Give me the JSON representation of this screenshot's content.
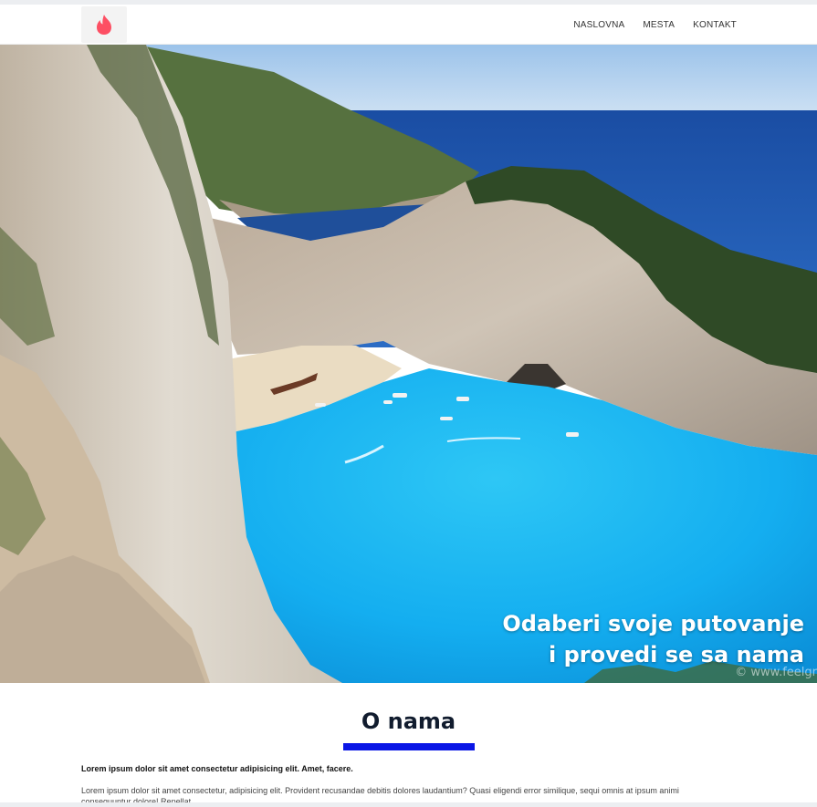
{
  "nav": {
    "items": [
      "NASLOVNA",
      "MESTA",
      "KONTAKT"
    ]
  },
  "hero": {
    "line1": "Odaberi svoje putovanje",
    "line2": "i provedi se sa nama",
    "watermark": "© www.feelgr"
  },
  "about": {
    "title": "O nama",
    "lead": "Lorem ipsum dolor sit amet consectetur adipisicing elit. Amet, facere.",
    "body": "Lorem ipsum dolor sit amet consectetur, adipisicing elit. Provident recusandae debitis dolores laudantium? Quasi eligendi error similique, sequi omnis at ipsum animi consequuntur dolore! Repellat."
  },
  "colors": {
    "accent": "#0a16e6",
    "logo": "#fd4f63"
  }
}
